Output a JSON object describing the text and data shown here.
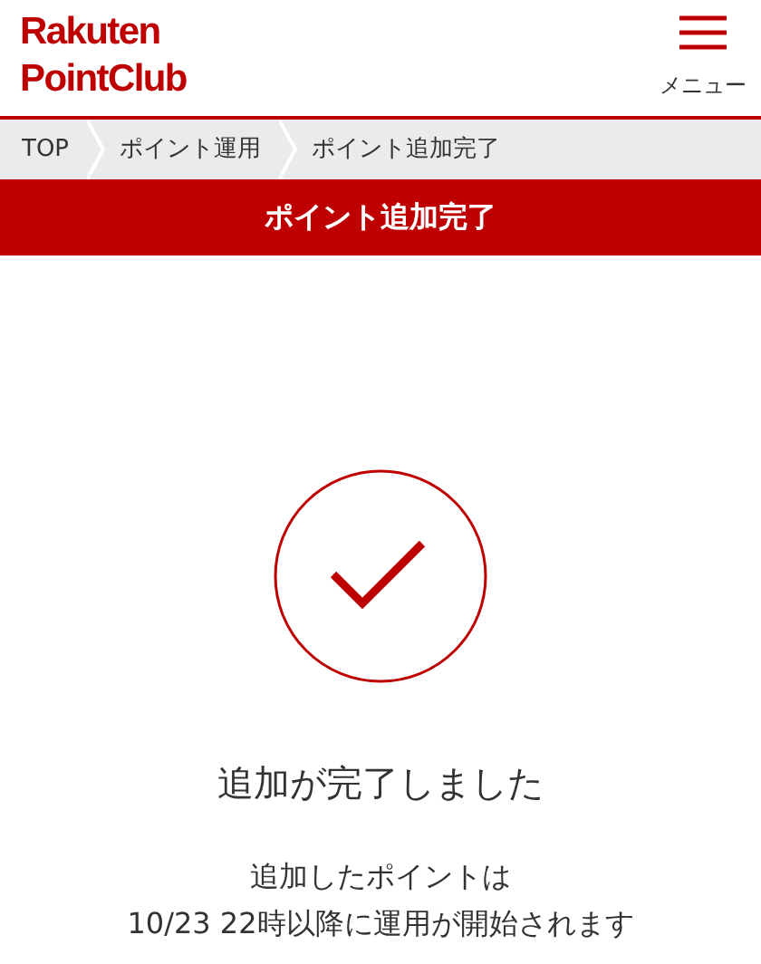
{
  "header": {
    "logo_line_1": "Rakuten",
    "logo_line_2": "PointClub",
    "menu_label": "メニュー"
  },
  "breadcrumb": [
    "TOP",
    "ポイント運用",
    "ポイント追加完了"
  ],
  "page_title": "ポイント追加完了",
  "result": {
    "heading": "追加が完了しました",
    "message_lines": [
      "追加したポイントは",
      "10/23 22時以降に運用が開始されます"
    ]
  }
}
